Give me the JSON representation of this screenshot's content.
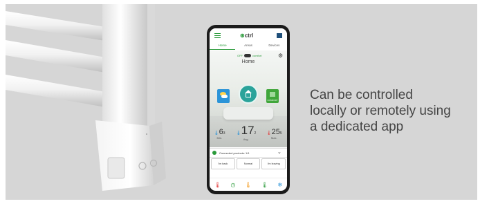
{
  "caption": {
    "line1": "Can be controlled",
    "line2": "locally or remotely using",
    "line3": "a dedicated app"
  },
  "app": {
    "logo": "ctrl",
    "tabs": [
      {
        "label": "Home",
        "active": true
      },
      {
        "label": "Areas",
        "active": false
      },
      {
        "label": "Devices",
        "active": false
      }
    ],
    "home_title": "Home",
    "mode_row_label": "OFF",
    "mode_row_label_right": "comfort",
    "mode_tile_label": "COMFORT",
    "temps": {
      "min": {
        "value": "6",
        "decimal": "3",
        "label": "Min."
      },
      "avg": {
        "value": "17",
        "decimal": "2",
        "label": "Avg."
      },
      "max": {
        "value": "25",
        "decimal": "5",
        "label": "Max."
      }
    },
    "connected_text": "Connected products: 1/1",
    "mode_buttons": [
      "I'm back",
      "Normal",
      "I'm leaving"
    ],
    "bottom_nav_icons": [
      "thermometer-red-icon",
      "clock-icon",
      "thermometer-orange-icon",
      "thermometer-green-icon",
      "snowflake-icon"
    ],
    "colors": {
      "accent": "#2a9a3a",
      "home_circle": "#2ba39a",
      "weather": "#2b94d8"
    }
  }
}
